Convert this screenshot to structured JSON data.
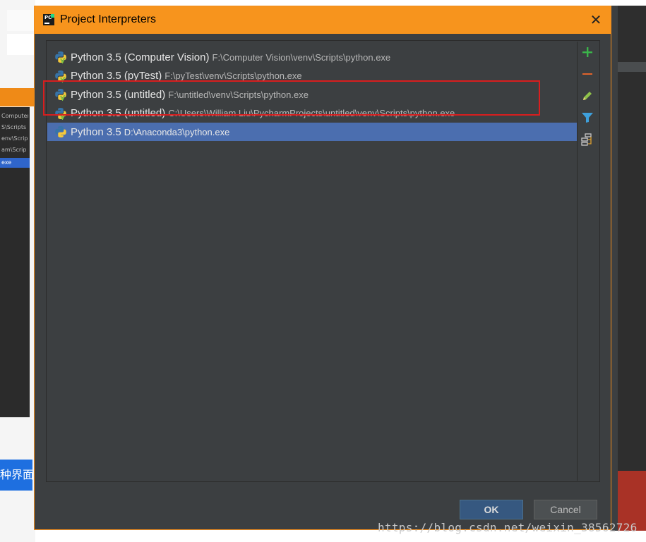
{
  "dialog": {
    "title": "Project Interpreters",
    "close_glyph": "✕",
    "app_icon_text": "PC"
  },
  "interpreters": [
    {
      "name": "Python 3.5 (Computer Vision)",
      "path": "F:\\Computer Vision\\venv\\Scripts\\python.exe",
      "icon": "python-venv-icon",
      "selected": false
    },
    {
      "name": "Python 3.5 (pyTest)",
      "path": "F:\\pyTest\\venv\\Scripts\\python.exe",
      "icon": "python-venv-icon",
      "selected": false
    },
    {
      "name": "Python 3.5 (untitled)",
      "path": "F:\\untitled\\venv\\Scripts\\python.exe",
      "icon": "python-venv-icon",
      "selected": false
    },
    {
      "name": "Python 3.5 (untitled)",
      "path": "C:\\Users\\William Liu\\PycharmProjects\\untitled\\venv\\Scripts\\python.exe",
      "icon": "python-venv-icon",
      "selected": false
    },
    {
      "name": "Python 3.5",
      "path": "D:\\Anaconda3\\python.exe",
      "icon": "python-icon",
      "selected": true
    }
  ],
  "toolbar": [
    {
      "name": "add-icon",
      "glyph": "+",
      "color": "#3bb54a"
    },
    {
      "name": "remove-icon",
      "glyph": "—",
      "color": "#e0632b"
    },
    {
      "name": "edit-icon",
      "glyph": "✎",
      "color": "#8fc24a"
    },
    {
      "name": "filter-icon",
      "glyph": "▼",
      "color": "#3ea0dc"
    },
    {
      "name": "show-paths-icon",
      "glyph": "tree",
      "color": "#c9c9c9"
    }
  ],
  "buttons": {
    "ok": "OK",
    "cancel": "Cancel"
  },
  "background": {
    "left_button_text": "种界面",
    "side_panel_lines": [
      "Computer",
      "S\\Scripts",
      "env\\Scrip",
      "am\\Scrip",
      "exe"
    ]
  },
  "watermark": "https://blog.csdn.net/weixin_38562726",
  "colors": {
    "title_bar": "#f7941d",
    "dialog_bg": "#3c3f41",
    "selection": "#4b6eaf",
    "highlight_border": "#d91e1e"
  }
}
